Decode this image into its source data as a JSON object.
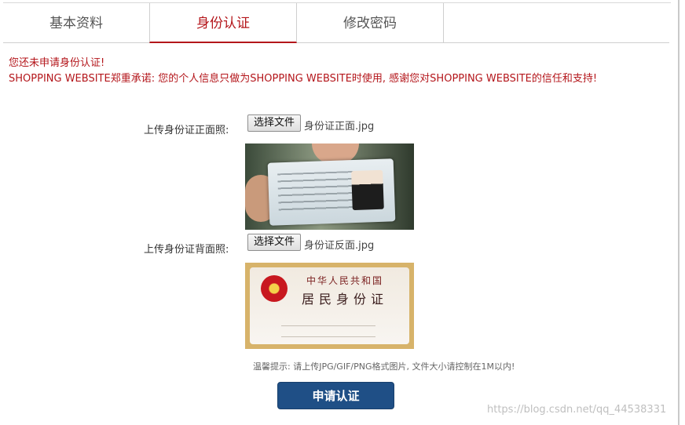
{
  "tabs": [
    {
      "label": "基本资料",
      "active": false
    },
    {
      "label": "身份认证",
      "active": true
    },
    {
      "label": "修改密码",
      "active": false
    }
  ],
  "notice": {
    "line1": "您还未申请身份认证!",
    "line2": "SHOPPING WEBSITE郑重承诺: 您的个人信息只做为SHOPPING WEBSITE时使用, 感谢您对SHOPPING WEBSITE的信任和支持!"
  },
  "front": {
    "label": "上传身份证正面照:",
    "button": "选择文件",
    "filename": "身份证正面.jpg"
  },
  "back": {
    "label": "上传身份证背面照:",
    "button": "选择文件",
    "filename": "身份证反面.jpg"
  },
  "id_back_image": {
    "title_small": "中华人民共和国",
    "title_large": "居民身份证"
  },
  "hint": "温馨提示: 请上传JPG/GIF/PNG格式图片, 文件大小请控制在1M以内!",
  "submit_label": "申请认证",
  "watermark": "https://blog.csdn.net/qq_44538331",
  "colors": {
    "accent": "#b4161b",
    "button": "#1f4f86"
  }
}
